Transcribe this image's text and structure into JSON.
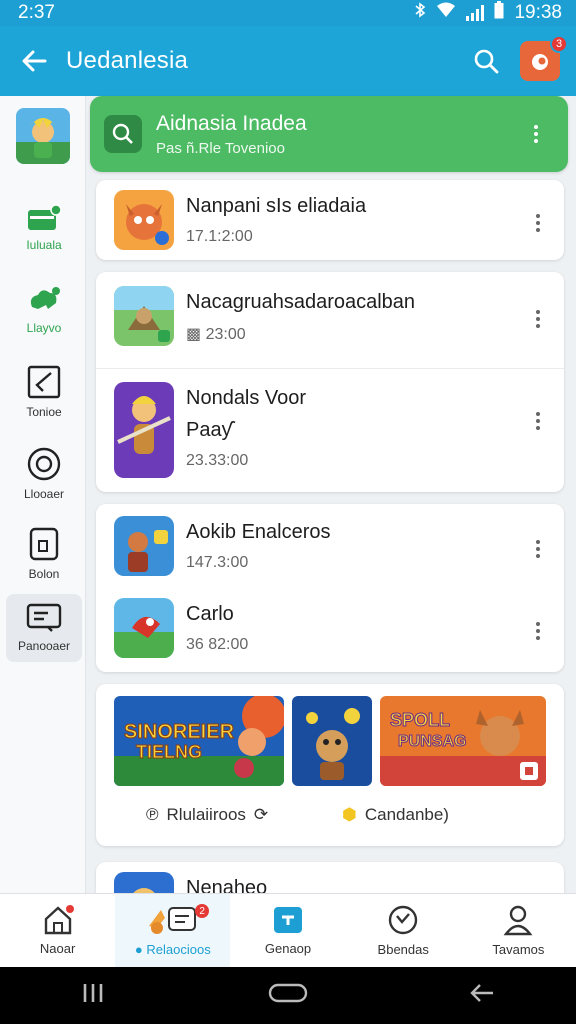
{
  "status_bar": {
    "time": "2:37",
    "right_time": "19:38"
  },
  "app_bar": {
    "title": "Uedanlesia"
  },
  "sidebar": {
    "items": [
      {
        "label": "Iuluala",
        "icon": "wallet-icon"
      },
      {
        "label": "Llayvo",
        "icon": "cloud-chat-icon"
      },
      {
        "label": "Tonioe",
        "icon": "arrow-box-icon"
      },
      {
        "label": "Llooaer",
        "icon": "record-icon"
      },
      {
        "label": "Bolon",
        "icon": "tablet-icon"
      },
      {
        "label": "Panooaer",
        "icon": "reader-icon"
      }
    ]
  },
  "header_card": {
    "title": "Aidnasia Inadea",
    "subtitle": "Pas ñ.Rle Tovenioo"
  },
  "items": [
    {
      "name": "Nanpani sIs eliadaia",
      "meta": "17.1:2:00"
    },
    {
      "name": "Nacagruahsadaroacalban",
      "meta": "23:00"
    },
    {
      "name": "Nondals Voor",
      "name2": "Paaƴ",
      "meta": "23.33:00"
    },
    {
      "name": "Aokib Enalceros",
      "meta": "147.3:00"
    },
    {
      "name": "Carlo",
      "meta": "36 82:00"
    }
  ],
  "banners": [
    {
      "text1": "SINOREIER",
      "text2": "TIELNG"
    },
    {
      "text1": "",
      "text2": ""
    },
    {
      "text1": "SPOLL",
      "text2": "PUNSAG"
    }
  ],
  "pills": [
    {
      "label": "Rlulaiiroos"
    },
    {
      "label": "Candanbe)"
    }
  ],
  "partial_item": {
    "name": "Nenaheo"
  },
  "bottom_nav": [
    {
      "label": "Naoar",
      "badge": ""
    },
    {
      "label": "Relaocioos",
      "badge": "2"
    },
    {
      "label": "Genaop",
      "badge": ""
    },
    {
      "label": "Bbendas",
      "badge": ""
    },
    {
      "label": "Tavamos",
      "badge": ""
    }
  ],
  "colors": {
    "primary": "#1ea5d8",
    "header_green": "#4cbb63",
    "badge_red": "#e53935"
  }
}
